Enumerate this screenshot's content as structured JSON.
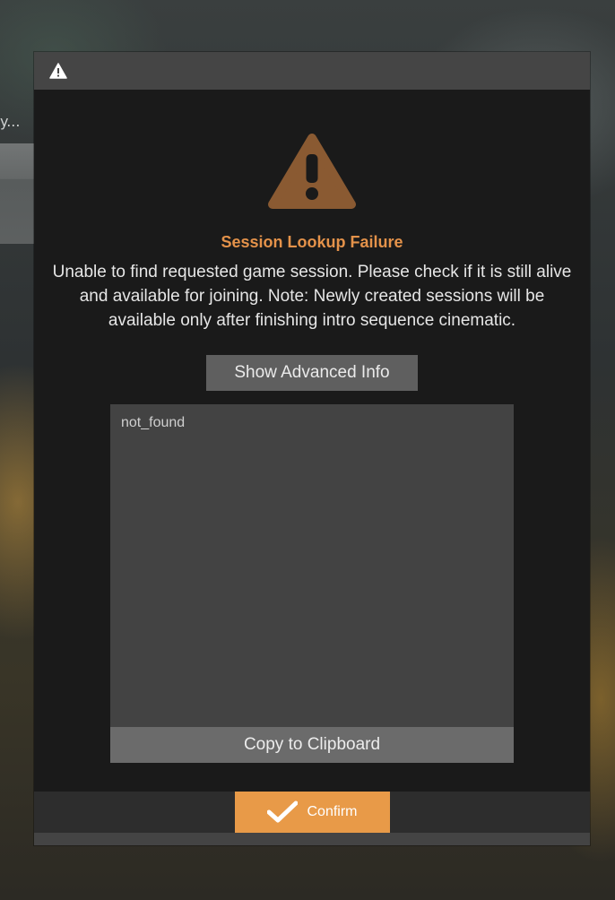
{
  "dialog": {
    "heading": "Session Lookup Failure",
    "message": "Unable to find requested game session. Please check if it is still alive and available for joining. Note: Newly created sessions will be available only after finishing intro sequence cinematic.",
    "advanced_button_label": "Show Advanced Info",
    "advanced_info_text": "not_found",
    "copy_button_label": "Copy to Clipboard",
    "confirm_button_label": "Confirm",
    "icons": {
      "title_icon": "warning-icon",
      "main_icon": "warning-icon",
      "confirm_icon": "checkmark-icon"
    },
    "colors": {
      "accent": "#e89a48",
      "heading": "#e4924a",
      "warning_icon": "#8a5a32"
    }
  },
  "background": {
    "partial_text": "y..."
  }
}
